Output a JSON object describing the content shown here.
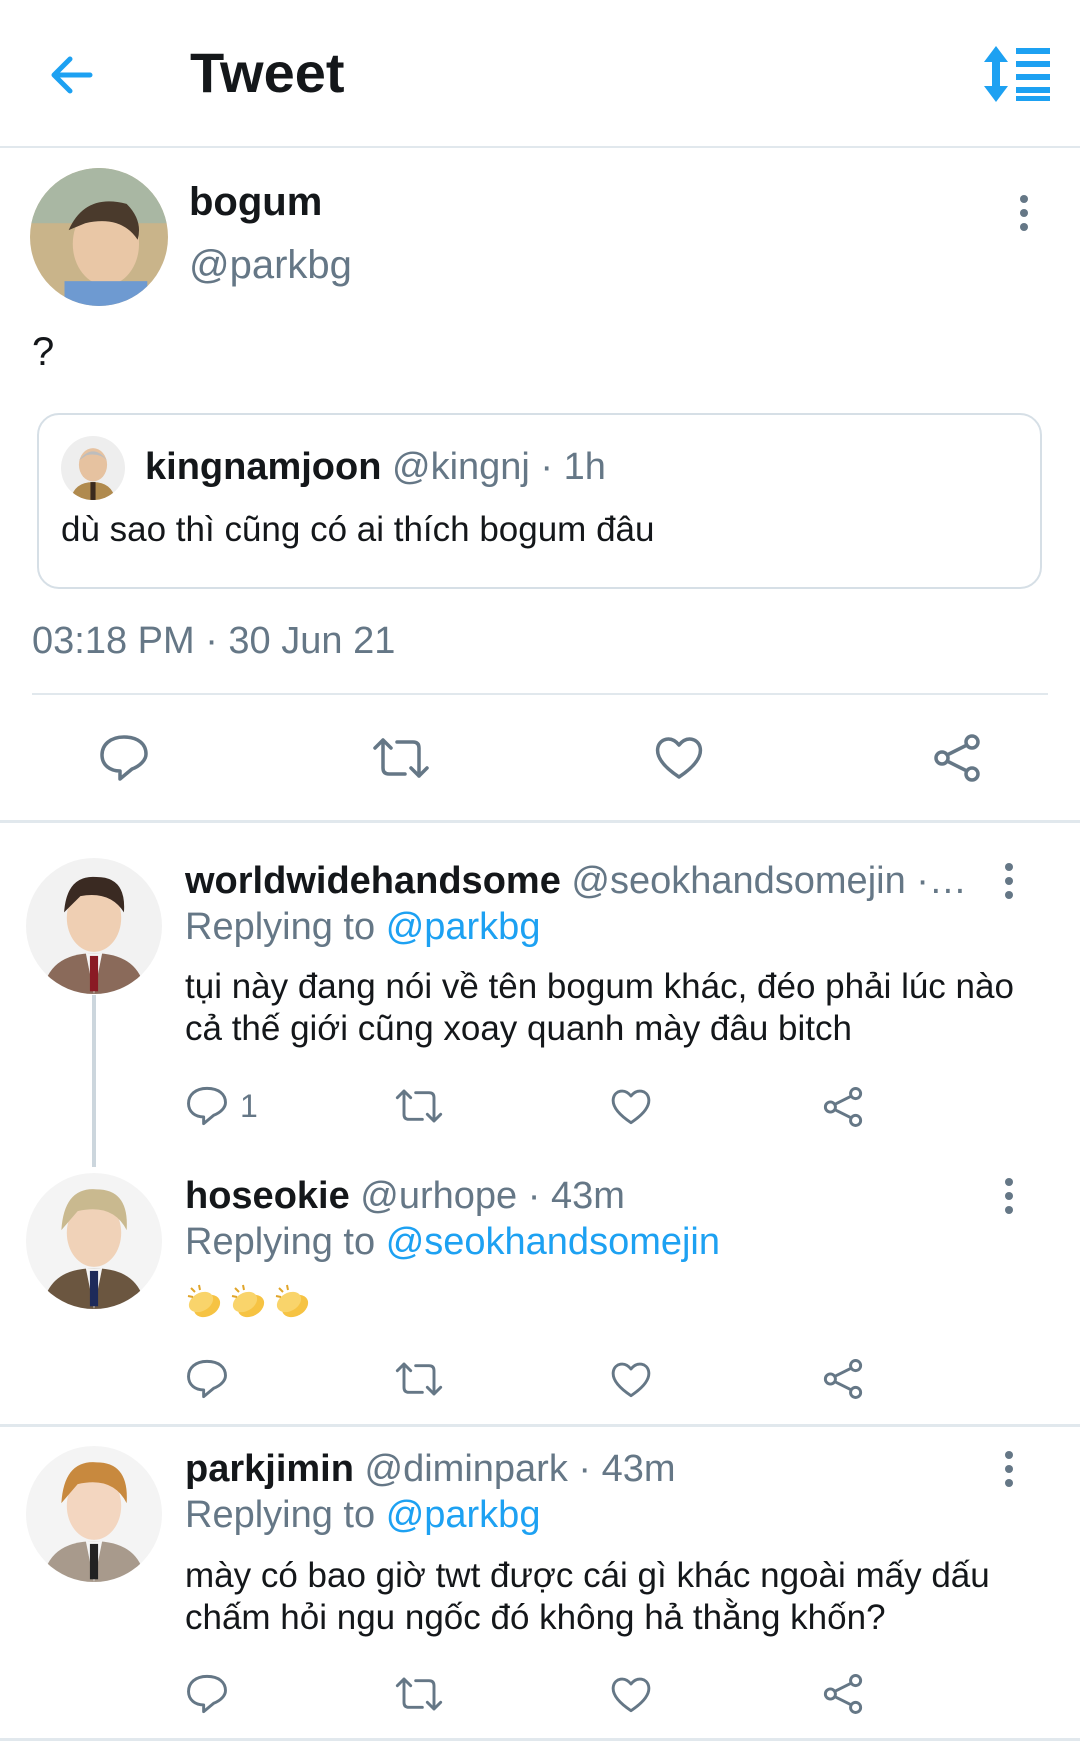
{
  "header": {
    "title": "Tweet",
    "back_icon": "back-arrow-icon",
    "sort_icon": "sort-timeline-icon",
    "accent": "#1da1f2"
  },
  "main_tweet": {
    "name": "bogum",
    "handle": "@parkbg",
    "text": "?",
    "timestamp": "03:18 PM · 30 Jun 21",
    "quoted": {
      "name": "kingnamjoon",
      "meta": "@kingnj · 1h",
      "text": "dù sao thì cũng có ai thích bogum đâu"
    }
  },
  "replies": [
    {
      "name": "worldwidehandsome",
      "meta": "@seokhandsomejin ·…",
      "replying_label": "Replying to",
      "replying_to": "@parkbg",
      "text": "tụi này đang nói về tên bogum khác, đéo phải lúc nào cả thế giới cũng xoay quanh mày đâu bitch",
      "reply_count": "1"
    },
    {
      "name": "hoseokie",
      "meta": "@urhope · 43m",
      "replying_label": "Replying to",
      "replying_to": "@seokhandsomejin",
      "emoji": "👏👏👏"
    },
    {
      "name": "parkjimin",
      "meta": "@diminpark · 43m",
      "replying_label": "Replying to",
      "replying_to": "@parkbg",
      "text": "mày có bao giờ twt được cái gì khác ngoài mấy dấu chấm hỏi ngu ngốc đó không hả thằng khốn?"
    }
  ],
  "colors": {
    "text": "#14171a",
    "secondary": "#657786",
    "link": "#1da1f2",
    "border": "#e1e8ed"
  }
}
